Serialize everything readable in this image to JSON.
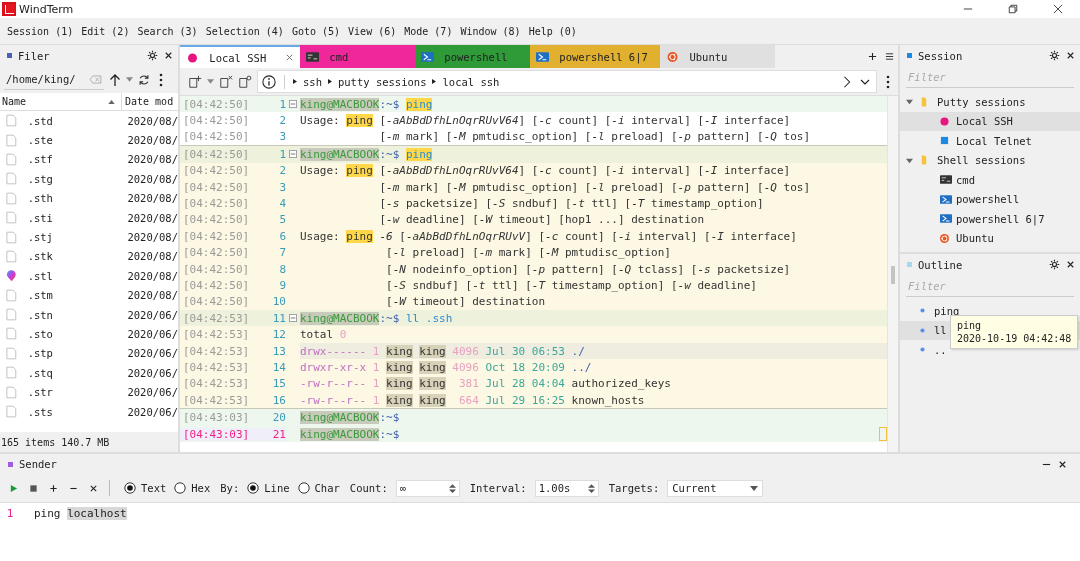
{
  "window": {
    "title": "WindTerm"
  },
  "menu": [
    "Session (1)",
    "Edit (2)",
    "Search (3)",
    "Selection (4)",
    "Goto (5)",
    "View (6)",
    "Mode (7)",
    "Window (8)",
    "Help (0)"
  ],
  "filer": {
    "title": "Filer",
    "path": "/home/king/",
    "columns": [
      "Name",
      "Date mod"
    ],
    "files": [
      {
        "name": ".std",
        "date": "2020/08/",
        "kind": "file"
      },
      {
        "name": ".ste",
        "date": "2020/08/",
        "kind": "file"
      },
      {
        "name": ".stf",
        "date": "2020/08/",
        "kind": "file"
      },
      {
        "name": ".stg",
        "date": "2020/08/",
        "kind": "file"
      },
      {
        "name": ".sth",
        "date": "2020/08/",
        "kind": "file"
      },
      {
        "name": ".sti",
        "date": "2020/08/",
        "kind": "file"
      },
      {
        "name": ".stj",
        "date": "2020/08/",
        "kind": "file"
      },
      {
        "name": ".stk",
        "date": "2020/08/",
        "kind": "file"
      },
      {
        "name": ".stl",
        "date": "2020/08/",
        "kind": "app"
      },
      {
        "name": ".stm",
        "date": "2020/08/",
        "kind": "file"
      },
      {
        "name": ".stn",
        "date": "2020/06/",
        "kind": "file"
      },
      {
        "name": ".sto",
        "date": "2020/06/",
        "kind": "file"
      },
      {
        "name": ".stp",
        "date": "2020/06/",
        "kind": "file"
      },
      {
        "name": ".stq",
        "date": "2020/06/",
        "kind": "file"
      },
      {
        "name": ".str",
        "date": "2020/06/",
        "kind": "file"
      },
      {
        "name": ".sts",
        "date": "2020/06/",
        "kind": "file"
      }
    ],
    "status": "165 items 140.7 MB"
  },
  "tabs": [
    {
      "label": "Local SSH",
      "kind": "dot",
      "color": "#e8157f",
      "selected": true
    },
    {
      "label": "cmd",
      "kind": "cmd",
      "color": "#f0279a",
      "selected": false
    },
    {
      "label": "powershell",
      "kind": "ps",
      "color": "#2e9a38",
      "selected": false
    },
    {
      "label": "powershell 6|7",
      "kind": "ps",
      "color": "#e0b02e",
      "selected": false
    },
    {
      "label": "Ubuntu",
      "kind": "ubuntu",
      "color": "#e0e0e0",
      "selected": false
    }
  ],
  "breadcrumb": [
    "ssh",
    "putty sessions",
    "local ssh"
  ],
  "terminal": {
    "top_pane": [
      {
        "time": "[04:42:50]",
        "num": "1",
        "kind": "prompt",
        "fold": true,
        "segments": [
          {
            "kind": "user",
            "text": "king@MACBOOK"
          },
          {
            "kind": "dir",
            "text": ":~$ "
          },
          {
            "kind": "hlcmd",
            "text": "ping"
          }
        ]
      },
      {
        "time": "[04:42:50]",
        "num": "2",
        "kind": "output",
        "segments": [
          {
            "kind": "text",
            "text": "Usage: "
          },
          {
            "kind": "hl",
            "text": "ping"
          },
          {
            "kind": "text",
            "text": " [*-aAbBdDfhLnOqrRUvV64*] [*-c* count] [*-i* interval] [*-I* interface]"
          }
        ]
      },
      {
        "time": "[04:42:50]",
        "num": "3",
        "kind": "output",
        "segments": [
          {
            "kind": "text",
            "text": "            [*-m* mark] [*-M* pmtudisc_option] [*-l* preload] [*-p* pattern] [*-Q* tos]"
          }
        ]
      }
    ],
    "main_pane": [
      {
        "time": "[04:42:50]",
        "num": "1",
        "kind": "prompt",
        "fold": true,
        "segments": [
          {
            "kind": "user",
            "text": "king@MACBOOK"
          },
          {
            "kind": "dir",
            "text": ":~$ "
          },
          {
            "kind": "hlcmd",
            "text": "ping"
          }
        ]
      },
      {
        "time": "[04:42:50]",
        "num": "2",
        "kind": "output",
        "segments": [
          {
            "kind": "text",
            "text": "Usage: "
          },
          {
            "kind": "hl",
            "text": "ping"
          },
          {
            "kind": "text",
            "text": " [*-aAbBdDfhLnOqrRUvV64*] [*-c* count] [*-i* interval] [*-I* interface]"
          }
        ]
      },
      {
        "time": "[04:42:50]",
        "num": "3",
        "kind": "output",
        "segments": [
          {
            "kind": "text",
            "text": "            [*-m* mark] [*-M* pmtudisc_option] [*-l* preload] [*-p* pattern] [*-Q* tos]"
          }
        ]
      },
      {
        "time": "[04:42:50]",
        "num": "4",
        "kind": "output",
        "segments": [
          {
            "kind": "text",
            "text": "            [*-s* packetsize] [*-S* sndbuf] [*-t* ttl] [*-T* timestamp_option]"
          }
        ]
      },
      {
        "time": "[04:42:50]",
        "num": "5",
        "kind": "output",
        "segments": [
          {
            "kind": "text",
            "text": "            [*-w* deadline] [*-W* timeout] [hop1 ...] destination"
          }
        ]
      },
      {
        "time": "[04:42:50]",
        "num": "6",
        "kind": "output",
        "segments": [
          {
            "kind": "text",
            "text": "Usage: "
          },
          {
            "kind": "hl",
            "text": "ping"
          },
          {
            "kind": "text",
            "text": " *-6* [*-aAbBdDfhLnOqrRUvV*] [*-c* count] [*-i* interval] [*-I* interface]"
          }
        ]
      },
      {
        "time": "[04:42:50]",
        "num": "7",
        "kind": "output",
        "segments": [
          {
            "kind": "text",
            "text": "             [*-l* preload] [*-m* mark] [*-M* pmtudisc_option]"
          }
        ]
      },
      {
        "time": "[04:42:50]",
        "num": "8",
        "kind": "output",
        "segments": [
          {
            "kind": "text",
            "text": "             [*-N* nodeinfo_option] [*-p* pattern] [*-Q* tclass] [*-s* packetsize]"
          }
        ]
      },
      {
        "time": "[04:42:50]",
        "num": "9",
        "kind": "output",
        "segments": [
          {
            "kind": "text",
            "text": "             [*-S* sndbuf] [*-t* ttl] [*-T* timestamp_option] [*-w* deadline]"
          }
        ]
      },
      {
        "time": "[04:42:50]",
        "num": "10",
        "kind": "output",
        "segments": [
          {
            "kind": "text",
            "text": "             [*-W* timeout] destination"
          }
        ]
      },
      {
        "time": "[04:42:53]",
        "num": "11",
        "kind": "prompt",
        "fold": true,
        "segments": [
          {
            "kind": "user",
            "text": "king@MACBOOK"
          },
          {
            "kind": "dir",
            "text": ":~$ "
          },
          {
            "kind": "cmd",
            "text": "ll .ssh"
          }
        ]
      },
      {
        "time": "[04:42:53]",
        "num": "12",
        "kind": "output",
        "segments": [
          {
            "kind": "text",
            "text": "total "
          },
          {
            "kind": "num",
            "text": "0"
          }
        ]
      },
      {
        "time": "[04:42:53]",
        "num": "13",
        "kind": "marked",
        "segments": [
          {
            "kind": "perm",
            "text": "drwx------"
          },
          {
            "kind": "num",
            "text": " 1 "
          },
          {
            "kind": "owner",
            "text": "king"
          },
          {
            "kind": "owner",
            "text": "king"
          },
          {
            "kind": "num",
            "text": " 4096 "
          },
          {
            "kind": "date",
            "text": "Jul 30 06:53"
          },
          {
            "kind": "dir",
            "text": " ./"
          }
        ]
      },
      {
        "time": "[04:42:53]",
        "num": "14",
        "kind": "output",
        "segments": [
          {
            "kind": "perm",
            "text": "drwxr-xr-x"
          },
          {
            "kind": "num",
            "text": " 1 "
          },
          {
            "kind": "owner",
            "text": "king"
          },
          {
            "kind": "owner",
            "text": "king"
          },
          {
            "kind": "num",
            "text": " 4096 "
          },
          {
            "kind": "date",
            "text": "Oct 18 20:09"
          },
          {
            "kind": "dir",
            "text": " ../"
          }
        ]
      },
      {
        "time": "[04:42:53]",
        "num": "15",
        "kind": "output",
        "segments": [
          {
            "kind": "perm",
            "text": "-rw-r--r--"
          },
          {
            "kind": "num",
            "text": " 1 "
          },
          {
            "kind": "owner",
            "text": "king"
          },
          {
            "kind": "owner",
            "text": "king"
          },
          {
            "kind": "num",
            "text": "  381 "
          },
          {
            "kind": "date",
            "text": "Jul 28 04:04"
          },
          {
            "kind": "text",
            "text": " authorized_keys"
          }
        ]
      },
      {
        "time": "[04:42:53]",
        "num": "16",
        "kind": "output",
        "segments": [
          {
            "kind": "perm",
            "text": "-rw-r--r--"
          },
          {
            "kind": "num",
            "text": " 1 "
          },
          {
            "kind": "owner",
            "text": "king"
          },
          {
            "kind": "owner",
            "text": "king"
          },
          {
            "kind": "num",
            "text": "  664 "
          },
          {
            "kind": "date",
            "text": "Jul 29 16:25"
          },
          {
            "kind": "text",
            "text": " known_hosts"
          }
        ]
      }
    ],
    "bottom_pane": [
      {
        "time": "[04:43:03]",
        "num": "20",
        "kind": "prompt",
        "cursor": false,
        "segments": [
          {
            "kind": "user",
            "text": "king@MACBOOK"
          },
          {
            "kind": "dir",
            "text": ":~$"
          }
        ]
      },
      {
        "time": "[04:43:03]",
        "num": "21",
        "kind": "current",
        "cursor": true,
        "segments": [
          {
            "kind": "user",
            "text": "king@MACBOOK"
          },
          {
            "kind": "dir",
            "text": ":~$ "
          }
        ]
      }
    ]
  },
  "session": {
    "title": "Session",
    "filter_placeholder": "Filter",
    "tree": [
      {
        "label": "Putty sessions",
        "expanded": true,
        "selected": false,
        "children": [
          {
            "label": "Local SSH",
            "kind": "dot",
            "color": "#e8157f",
            "selected": true
          },
          {
            "label": "Local Telnet",
            "kind": "square",
            "color": "#1e88e5",
            "selected": false
          }
        ]
      },
      {
        "label": "Shell sessions",
        "expanded": true,
        "selected": false,
        "children": [
          {
            "label": "cmd",
            "kind": "cmd",
            "selected": false
          },
          {
            "label": "powershell",
            "kind": "ps",
            "selected": false
          },
          {
            "label": "powershell 6|7",
            "kind": "ps",
            "selected": false
          },
          {
            "label": "Ubuntu",
            "kind": "ubuntu",
            "selected": false
          }
        ]
      }
    ]
  },
  "outline": {
    "title": "Outline",
    "filter_placeholder": "Filter",
    "items": [
      {
        "label": "ping",
        "selected": false
      },
      {
        "label": "ll",
        "selected": true
      },
      {
        "label": "..",
        "selected": false
      }
    ],
    "tooltip": [
      "ping",
      "2020-10-19 04:42:48"
    ]
  },
  "sender": {
    "title": "Sender",
    "modes": [
      {
        "label": "Text",
        "selected": true
      },
      {
        "label": "Hex",
        "selected": false
      }
    ],
    "by_label": "By:",
    "units": [
      {
        "label": "Line",
        "selected": true
      },
      {
        "label": "Char",
        "selected": false
      }
    ],
    "count": {
      "label": "Count:",
      "value": "∞"
    },
    "interval": {
      "label": "Interval:",
      "value": "1.00s"
    },
    "targets": {
      "label": "Targets:",
      "value": "Current"
    },
    "lines": [
      {
        "num": "1",
        "segments": [
          {
            "kind": "text",
            "text": "ping "
          },
          {
            "kind": "sel",
            "text": "localhost"
          }
        ]
      }
    ]
  }
}
